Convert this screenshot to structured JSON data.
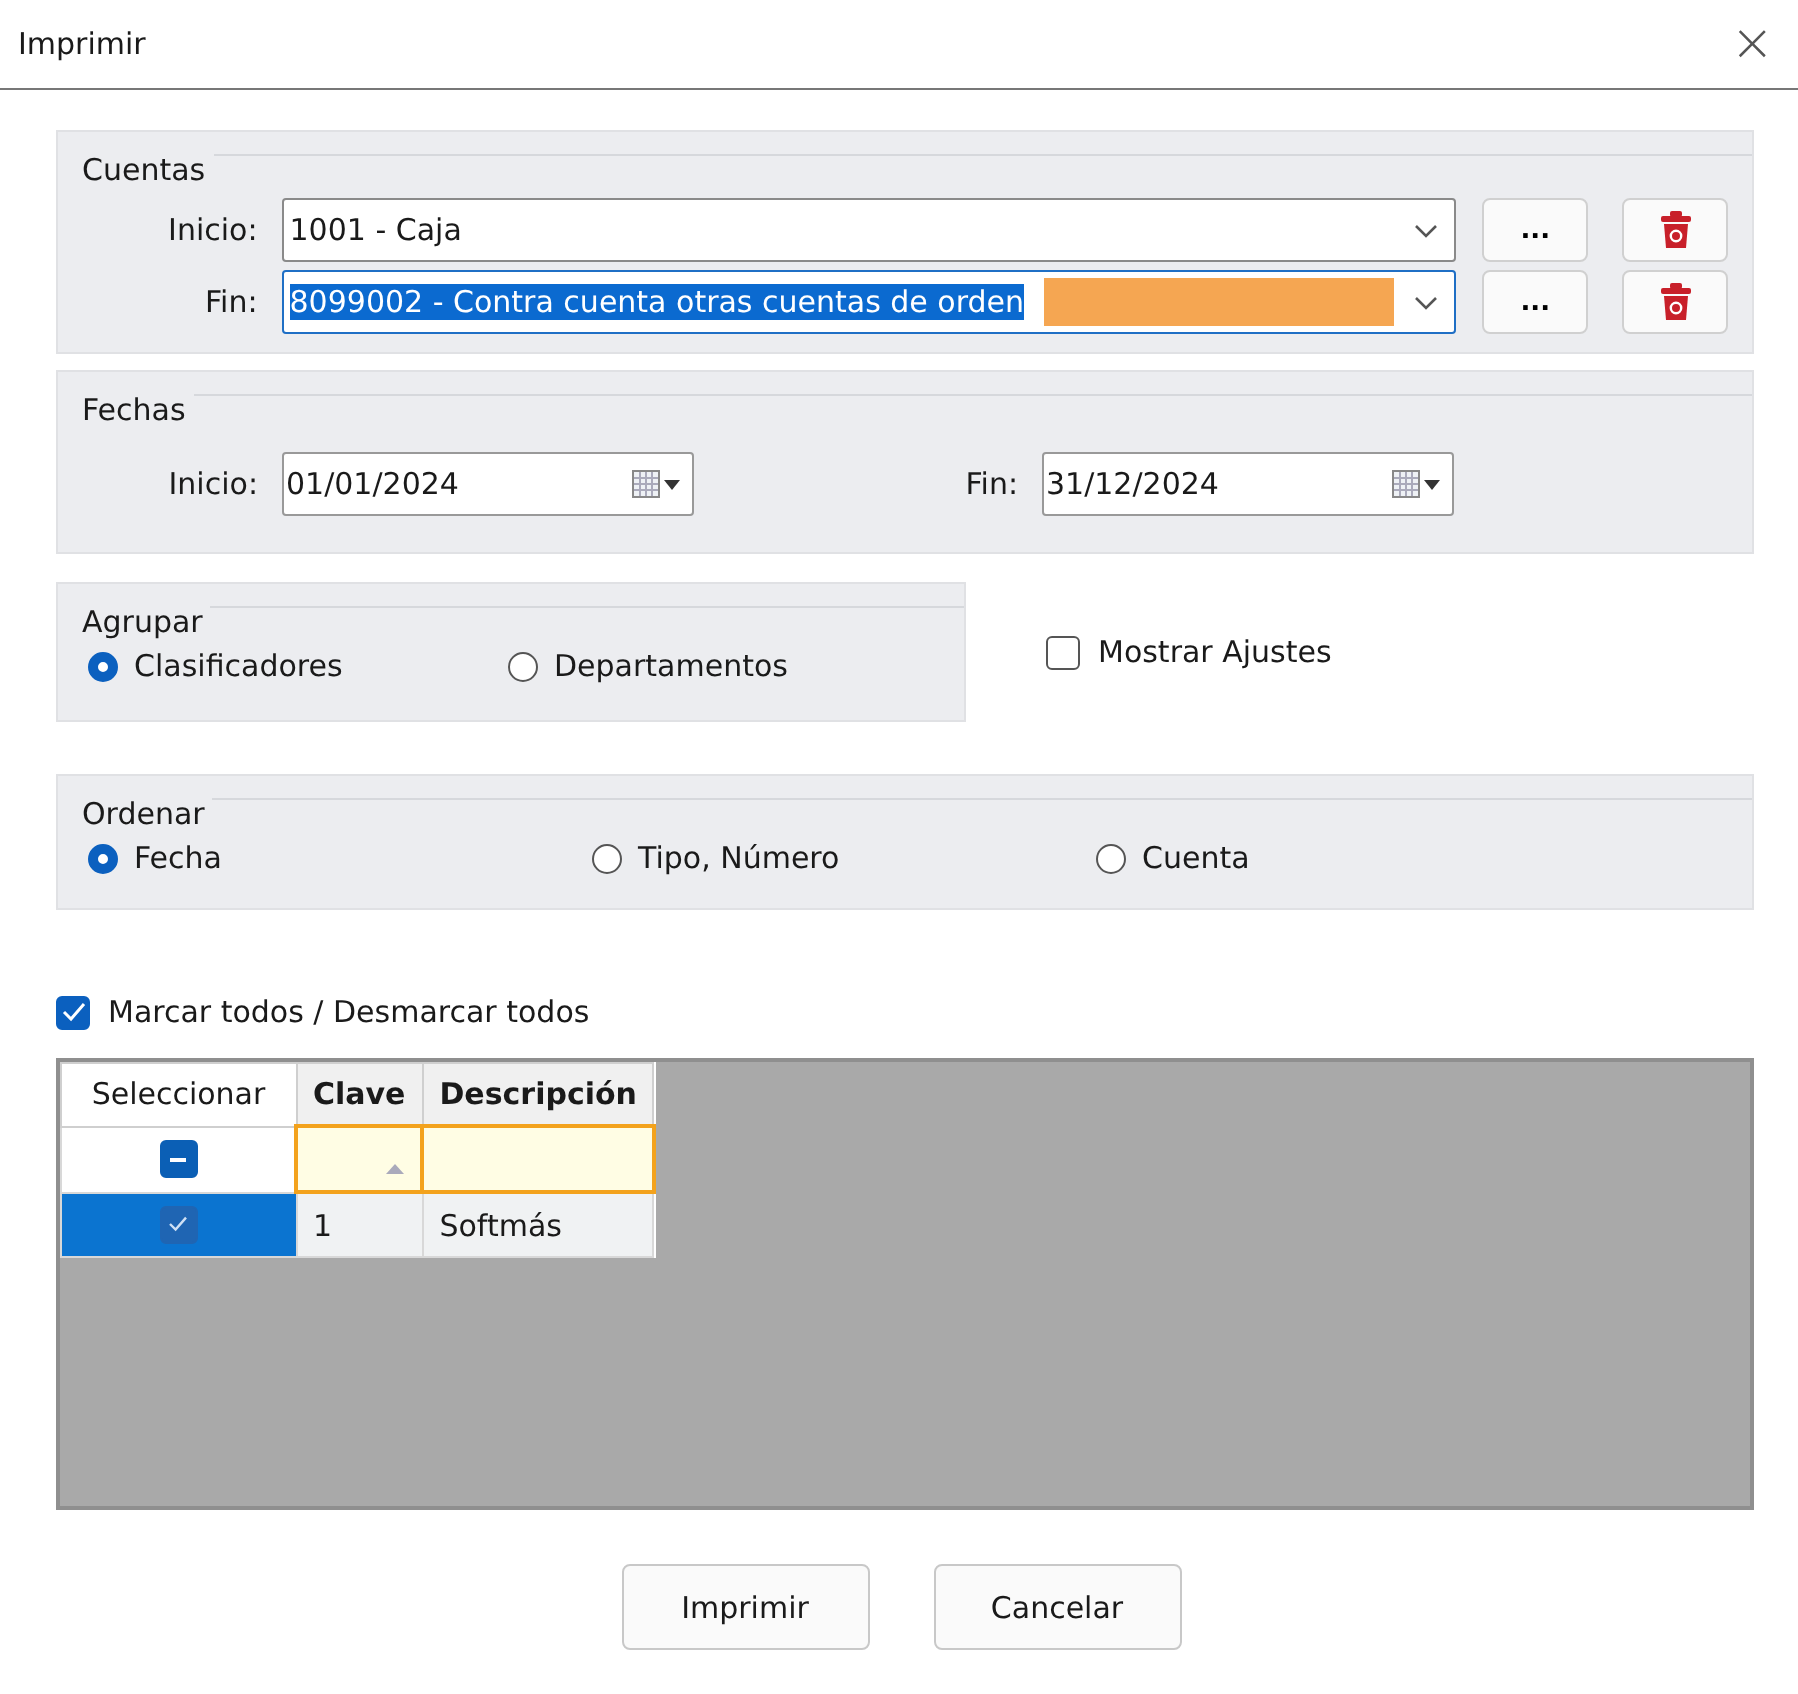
{
  "window": {
    "title": "Imprimir",
    "close": "×"
  },
  "cuentas": {
    "title": "Cuentas",
    "fields": [
      {
        "label": "Inicio:",
        "value": "1001 - Caja",
        "focused": false,
        "text_selected": false,
        "browse": "..."
      },
      {
        "label": "Fin:",
        "value": "8099002 - Contra cuenta otras cuentas de orden",
        "focused": true,
        "text_selected": true,
        "browse": "..."
      }
    ]
  },
  "fechas": {
    "title": "Fechas",
    "fields": [
      {
        "label": "Inicio:",
        "value": "01/01/2024"
      },
      {
        "label": "Fin:",
        "value": "31/12/2024"
      }
    ]
  },
  "agrupar": {
    "title": "Agrupar",
    "options": [
      {
        "label": "Clasificadores",
        "selected": true
      },
      {
        "label": "Departamentos",
        "selected": false
      }
    ]
  },
  "mostrar_ajustes": {
    "label": "Mostrar Ajustes",
    "checked": false
  },
  "ordenar": {
    "title": "Ordenar",
    "options": [
      {
        "label": "Fecha",
        "selected": true
      },
      {
        "label": "Tipo, Número",
        "selected": false
      },
      {
        "label": "Cuenta",
        "selected": false
      }
    ]
  },
  "marcar_todos": {
    "label": "Marcar todos / Desmarcar todos",
    "checked": true
  },
  "table": {
    "columns": [
      "Seleccionar",
      "Clave",
      "Descripción"
    ],
    "select_all": {
      "indeterminate": true
    },
    "rows": [
      {
        "selected": true,
        "checked": true,
        "cells": [
          "",
          "1",
          "Softmás"
        ]
      }
    ]
  },
  "buttons": [
    "Imprimir",
    "Cancelar"
  ]
}
